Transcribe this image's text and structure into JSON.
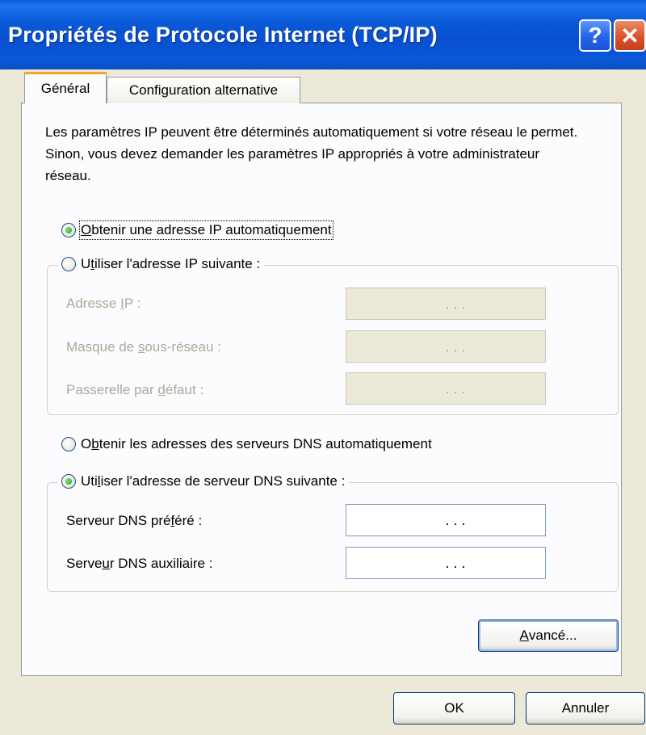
{
  "window": {
    "title": "Propriétés de Protocole Internet (TCP/IP)",
    "help_label": "?",
    "close_label": "✕"
  },
  "tabs": [
    {
      "label": "Général",
      "active": true
    },
    {
      "label": "Configuration alternative",
      "active": false
    }
  ],
  "description": "Les paramètres IP peuvent être déterminés automatiquement si votre réseau le permet. Sinon, vous devez demander les paramètres IP appropriés à votre administrateur réseau.",
  "ip": {
    "auto_option": {
      "prefix": "",
      "accel": "O",
      "rest": "btenir une adresse IP automatiquement",
      "selected": true
    },
    "manual_option": {
      "prefix": "U",
      "accel": "t",
      "rest": "iliser l'adresse IP suivante :",
      "selected": false
    },
    "fields": [
      {
        "pre": "Adresse ",
        "accel": "I",
        "post": "P :",
        "value": ". . ."
      },
      {
        "pre": "Masque de ",
        "accel": "s",
        "post": "ous-réseau :",
        "value": ". . ."
      },
      {
        "pre": "Passerelle par ",
        "accel": "d",
        "post": "éfaut :",
        "value": ". . ."
      }
    ]
  },
  "dns": {
    "auto_option": {
      "prefix": "O",
      "accel": "b",
      "rest": "tenir les adresses des serveurs DNS automatiquement",
      "selected": false
    },
    "manual_option": {
      "prefix": "Uti",
      "accel": "l",
      "rest": "iser l'adresse de serveur DNS suivante :",
      "selected": true
    },
    "fields": [
      {
        "pre": "Serveur DNS pré",
        "accel": "f",
        "post": "éré :",
        "value": ". . ."
      },
      {
        "pre": "Serve",
        "accel": "u",
        "post": "r DNS auxiliaire :",
        "value": ". . ."
      }
    ]
  },
  "buttons": {
    "advanced": {
      "accel": "A",
      "rest": "vancé..."
    },
    "ok": "OK",
    "cancel": "Annuler"
  }
}
